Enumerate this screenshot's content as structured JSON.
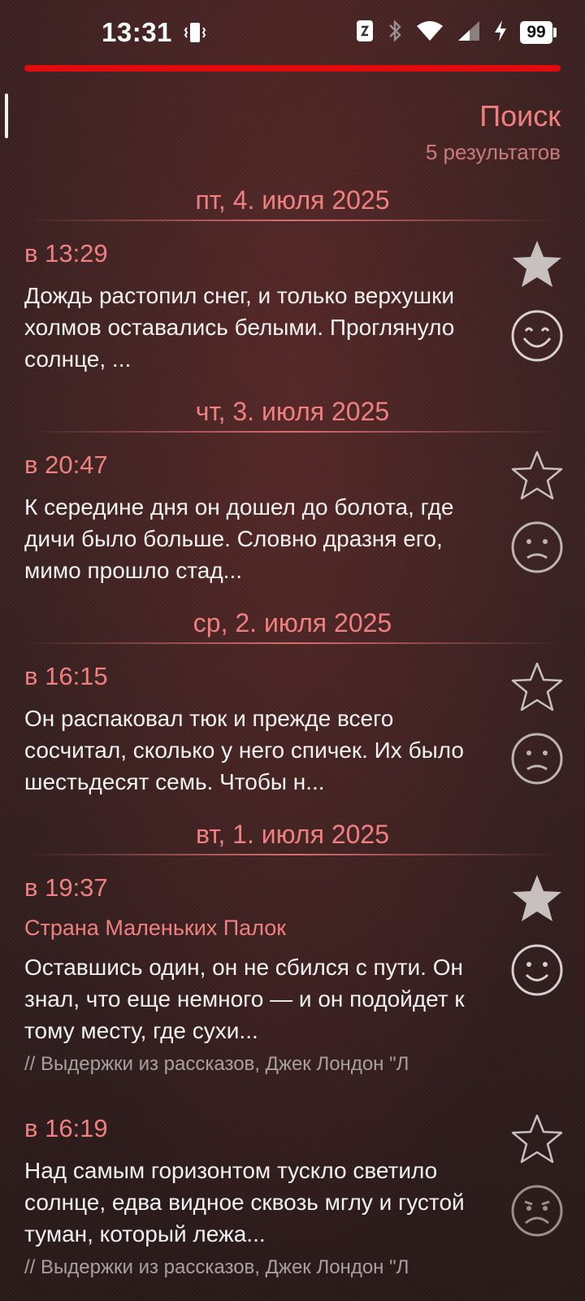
{
  "status_bar": {
    "time": "13:31",
    "battery": "99",
    "icons": [
      "vibrate-icon",
      "nfc-icon",
      "bluetooth-icon",
      "wifi-icon",
      "signal-icon",
      "charging-icon",
      "battery-icon"
    ]
  },
  "accent_color": "#f08080",
  "progress_color": "#e20b0b",
  "header": {
    "title": "Поиск",
    "subtitle": "5 результатов"
  },
  "dates": [
    {
      "label": "пт, 4. июля 2025"
    },
    {
      "label": "чт, 3. июля 2025"
    },
    {
      "label": "ср, 2. июля 2025"
    },
    {
      "label": "вт, 1. июля 2025"
    }
  ],
  "entries": [
    {
      "time": "в 13:29",
      "text": "Дождь растопил снег, и только верхушки холмов оставались белыми. Проглянуло солнце, ...",
      "starred": true,
      "mood": "very-happy-face-icon"
    },
    {
      "time": "в 20:47",
      "text": "К середине дня он дошел до болота, где дичи было больше. Словно дразня его, мимо прошло стад...",
      "starred": false,
      "mood": "sad-face-icon"
    },
    {
      "time": "в 16:15",
      "text": "Он распаковал тюк и прежде всего сосчитал, сколько у него спичек. Их было шестьдесят семь. Чтобы н...",
      "starred": false,
      "mood": "sad-face-icon"
    },
    {
      "time": "в 19:37",
      "title": "Страна Маленьких Палок",
      "text": "Оставшись один, он не сбился с пути. Он знал, что еще немного — и он подойдет к тому месту, где сухи...",
      "source": "// Выдержки из рассказов, Джек Лондон \"Л",
      "starred": true,
      "mood": "happy-face-icon"
    },
    {
      "time": "в 16:19",
      "text": "Над самым горизонтом тускло светило солнце, едва видное сквозь мглу и густой туман, который лежа...",
      "source": "// Выдержки из рассказов, Джек Лондон \"Л",
      "starred": false,
      "mood": "very-sad-face-icon"
    }
  ]
}
